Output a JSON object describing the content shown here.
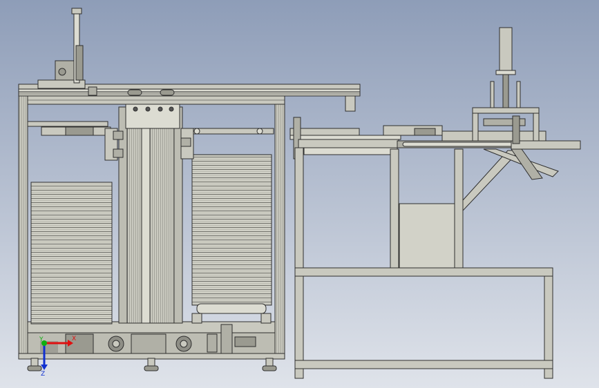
{
  "viewport": {
    "background_top": "#8e9db8",
    "background_bottom": "#dfe3ea",
    "part_fill": "#c9c9bf",
    "part_light": "#dcdcd2",
    "part_dark": "#9a9a90",
    "edge": "#2e2e2e"
  },
  "triad": {
    "x_label": "X",
    "y_label": "Y",
    "z_label": "Z",
    "x_color": "#e01010",
    "y_color": "#10b010",
    "z_color": "#1030d0"
  }
}
